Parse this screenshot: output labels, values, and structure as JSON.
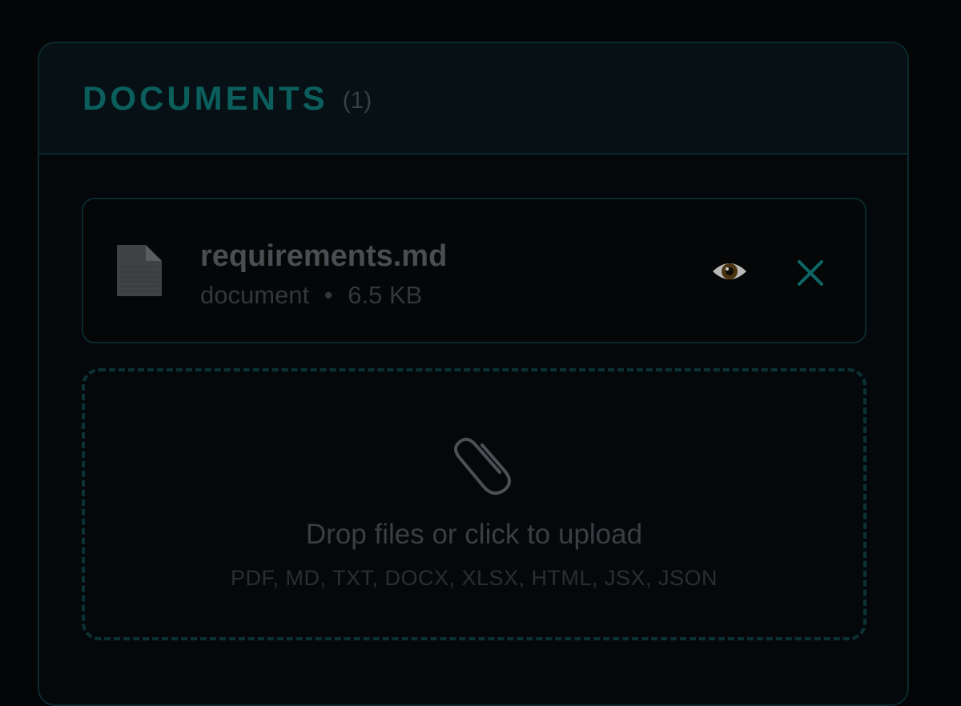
{
  "header": {
    "title": "DOCUMENTS",
    "count": "(1)"
  },
  "files": [
    {
      "name": "requirements.md",
      "type": "document",
      "separator": "•",
      "size": "6.5 KB",
      "icon": "document-icon",
      "preview_icon": "eye-icon",
      "remove_icon": "close-icon"
    }
  ],
  "dropzone": {
    "icon": "paperclip-icon",
    "title": "Drop files or click to upload",
    "types": "PDF, MD, TXT, DOCX, XLSX, HTML, JSX, JSON"
  },
  "colors": {
    "accent": "#0b5e5c",
    "border": "#0b2a2c",
    "background": "#040507"
  }
}
